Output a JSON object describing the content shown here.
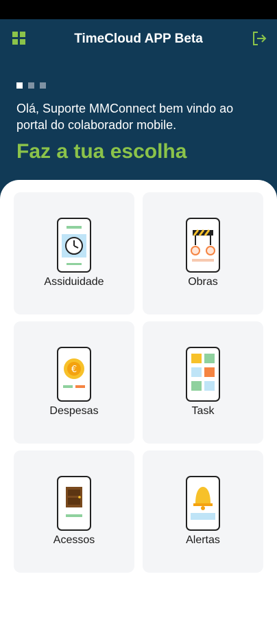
{
  "app": {
    "title": "TimeCloud APP Beta"
  },
  "header": {
    "welcome": "Olá, Suporte MMConnect bem vindo ao portal do colaborador mobile.",
    "heading": "Faz a tua escolha",
    "carousel": {
      "count": 3,
      "active": 0
    }
  },
  "icons": {
    "menu": "grid-menu-icon",
    "logout": "logout-icon"
  },
  "colors": {
    "header_bg": "#113a56",
    "accent": "#8bc34a",
    "card_bg": "#f4f5f7"
  },
  "tiles": [
    {
      "label": "Assiduidade",
      "icon": "clock-phone-icon"
    },
    {
      "label": "Obras",
      "icon": "construction-phone-icon"
    },
    {
      "label": "Despesas",
      "icon": "coin-phone-icon"
    },
    {
      "label": "Task",
      "icon": "tasks-phone-icon"
    },
    {
      "label": "Acessos",
      "icon": "door-phone-icon"
    },
    {
      "label": "Alertas",
      "icon": "bell-phone-icon"
    }
  ]
}
